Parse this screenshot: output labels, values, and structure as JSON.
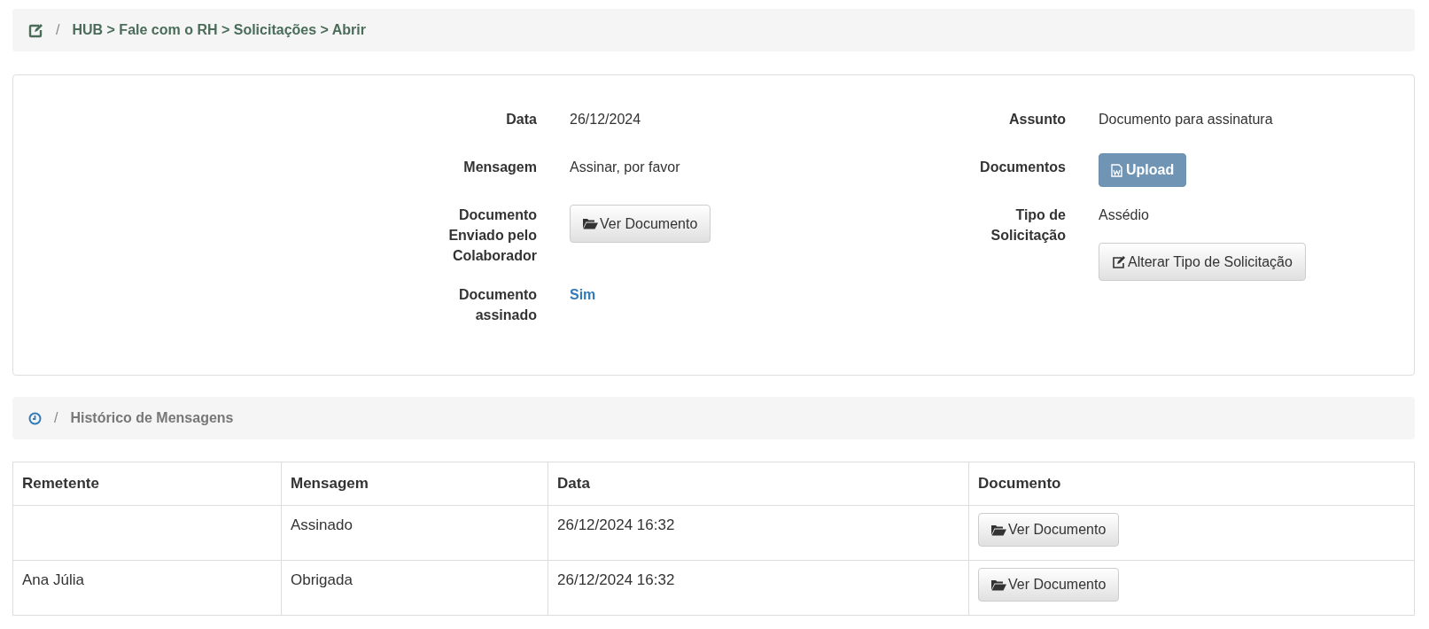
{
  "breadcrumb": {
    "separator": "/",
    "path": "HUB > Fale com o RH > Solicitações > Abrir"
  },
  "details": {
    "left": [
      {
        "label": "Data",
        "kind": "text",
        "value": "26/12/2024"
      },
      {
        "label": "Mensagem",
        "kind": "text",
        "value": "Assinar, por favor"
      },
      {
        "label": "Documento Enviado pelo Colaborador",
        "kind": "button",
        "value": "Ver Documento"
      },
      {
        "label": "Documento assinado",
        "kind": "link",
        "value": "Sim"
      }
    ],
    "right": [
      {
        "label": "Assunto",
        "kind": "text",
        "value": "Documento para assinatura"
      },
      {
        "label": "Documentos",
        "kind": "upload",
        "value": "Upload"
      },
      {
        "label": "Tipo de Solicitação",
        "kind": "text_with_button",
        "value": "Assédio",
        "button": "Alterar Tipo de Solicitação"
      }
    ]
  },
  "history_bar": {
    "separator": "/",
    "title": "Histórico de Mensagens"
  },
  "table": {
    "columns": [
      "Remetente",
      "Mensagem",
      "Data",
      "Documento"
    ],
    "rows": [
      {
        "sender": "",
        "message": "Assinado",
        "date": "26/12/2024 16:32",
        "document": "Ver Documento"
      },
      {
        "sender": "Ana Júlia",
        "message": "Obrigada",
        "date": "26/12/2024 16:32",
        "document": "Ver Documento"
      }
    ]
  }
}
